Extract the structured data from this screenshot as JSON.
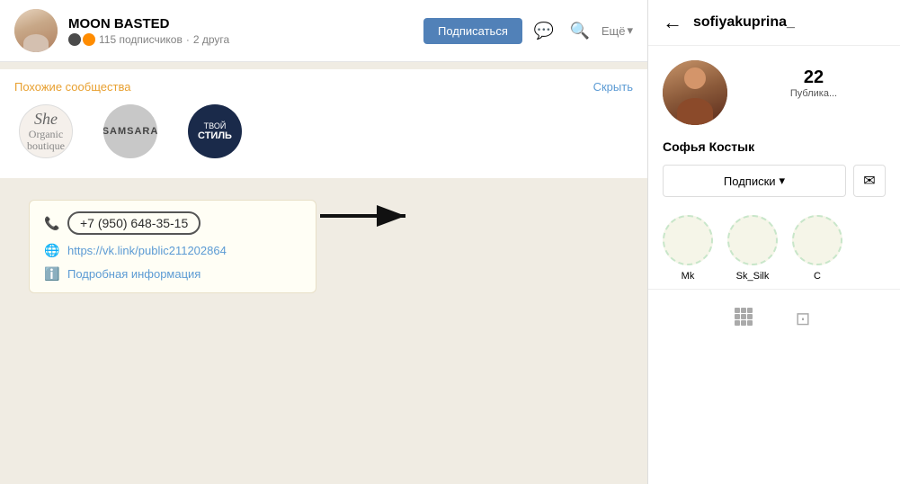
{
  "left": {
    "community": {
      "name": "MOON BASTED",
      "subscribers": "115 подписчиков",
      "friends": "2 друга",
      "subscribe_btn": "Подписаться",
      "more_btn": "Ещё"
    },
    "similar": {
      "title": "Похожие сообщества",
      "hide_btn": "Скрыть",
      "items": [
        {
          "id": "she",
          "name": "She",
          "sub": "Organic boutique"
        },
        {
          "id": "samsara",
          "name": "SAMSARA"
        },
        {
          "id": "style",
          "name": "ТВОЙ СТИЛЬ",
          "line1": "ТВОЙ",
          "line2": "СТИЛЬ"
        }
      ]
    },
    "info": {
      "phone": "+7 (950) 648-35-15",
      "link": "https://vk.link/public211202864",
      "detail": "Подробная информация"
    }
  },
  "right": {
    "back_label": "←",
    "username": "sofiyakuprina_",
    "profile": {
      "full_name": "Софья Костык",
      "stats_number": "22",
      "stats_label": "Публика...",
      "subscriptions_btn": "Подписки",
      "chevron": "▾"
    },
    "highlights": [
      {
        "label": "Mk"
      },
      {
        "label": "Sk_Silk"
      },
      {
        "label": "C"
      }
    ]
  }
}
